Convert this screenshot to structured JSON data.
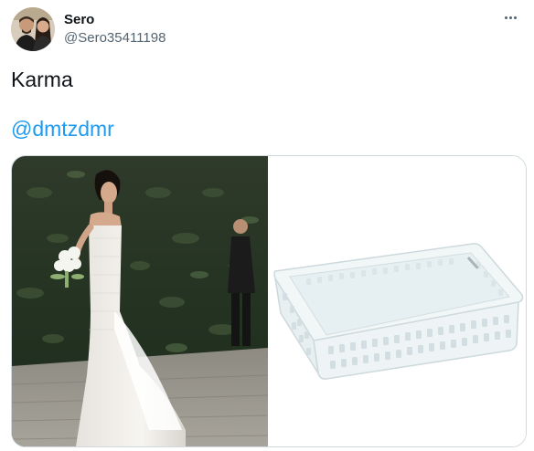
{
  "tweet": {
    "author": {
      "display_name": "Sero",
      "handle": "@Sero35411198"
    },
    "text": "Karma",
    "mention": "@dmtzdmr",
    "more_icon": "more-horizontal-icon"
  },
  "media": {
    "photos": [
      {
        "subject": "bride-in-wedding-dress"
      },
      {
        "subject": "white-plastic-basket"
      }
    ]
  }
}
